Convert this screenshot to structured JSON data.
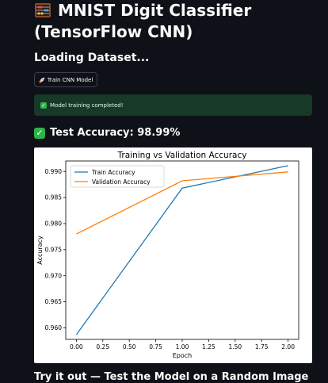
{
  "app": {
    "title": "MNIST Digit Classifier (TensorFlow CNN)",
    "subheader": "Loading Dataset...",
    "train_button_label": "Train CNN Model",
    "success_message": "Model training completed!",
    "accuracy_text": "Test Accuracy: 98.99%",
    "next_section_title": "Try it out — Test the Model on a Random Image"
  },
  "colors": {
    "background": "#0e1117",
    "success_bg": "#173928",
    "check_green": "#2db34a",
    "train_line": "#1f77b4",
    "val_line": "#ff7f0e"
  },
  "chart_data": {
    "type": "line",
    "title": "Training vs Validation Accuracy",
    "xlabel": "Epoch",
    "ylabel": "Accuracy",
    "xlim": [
      -0.1,
      2.1
    ],
    "ylim": [
      0.9578,
      0.992
    ],
    "xticks": [
      0.0,
      0.25,
      0.5,
      0.75,
      1.0,
      1.25,
      1.5,
      1.75,
      2.0
    ],
    "xtick_labels": [
      "0.00",
      "0.25",
      "0.50",
      "0.75",
      "1.00",
      "1.25",
      "1.50",
      "1.75",
      "2.00"
    ],
    "yticks": [
      0.96,
      0.965,
      0.97,
      0.975,
      0.98,
      0.985,
      0.99
    ],
    "ytick_labels": [
      "0.960",
      "0.965",
      "0.970",
      "0.975",
      "0.980",
      "0.985",
      "0.990"
    ],
    "legend_position": "top-left",
    "grid": false,
    "x": [
      0,
      1,
      2
    ],
    "series": [
      {
        "name": "Train Accuracy",
        "color": "#1f77b4",
        "values": [
          0.9587,
          0.9868,
          0.9911
        ]
      },
      {
        "name": "Validation Accuracy",
        "color": "#ff7f0e",
        "values": [
          0.978,
          0.9882,
          0.9899
        ]
      }
    ]
  }
}
